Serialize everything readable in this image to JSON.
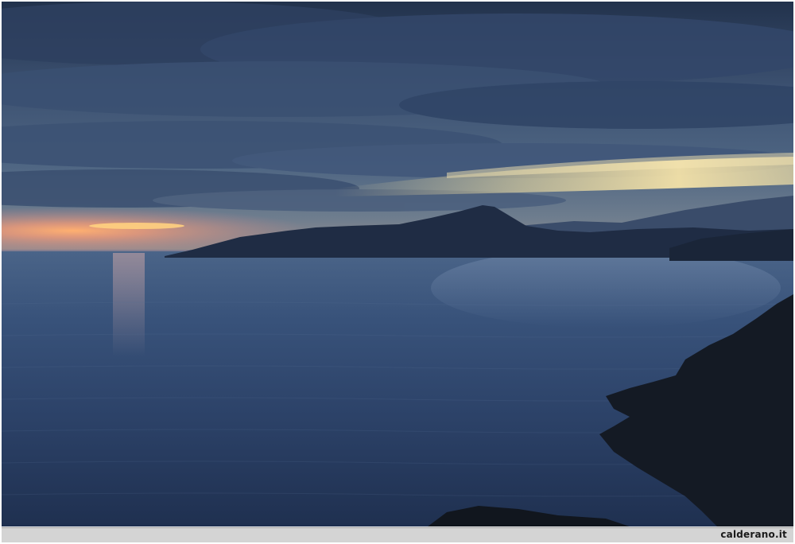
{
  "watermark": {
    "text": "calderano.it"
  },
  "colors": {
    "sky_top": "#2a3a55",
    "sky_mid": "#4d6480",
    "sunset_glow": "#f0a070",
    "horizon_gold": "#e8d8a0",
    "sea": "#2c4268",
    "sea_deep": "#1f3050",
    "land": "#1a2436",
    "foreground": "#141a22",
    "caption_bar": "#d4d4d4"
  }
}
